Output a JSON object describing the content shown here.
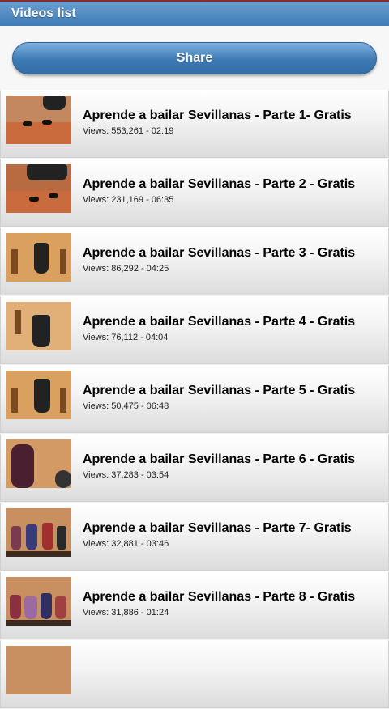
{
  "header": {
    "title": "Videos list"
  },
  "share": {
    "label": "Share"
  },
  "videos": [
    {
      "title": "Aprende a bailar Sevillanas - Parte 1- Gratis",
      "meta": "Views: 553,261 - 02:19"
    },
    {
      "title": "Aprende a bailar Sevillanas - Parte 2 - Gratis",
      "meta": "Views: 231,169 - 06:35"
    },
    {
      "title": "Aprende a bailar Sevillanas - Parte 3 - Gratis",
      "meta": "Views: 86,292 - 04:25"
    },
    {
      "title": "Aprende a bailar Sevillanas - Parte 4 - Gratis",
      "meta": "Views: 76,112 - 04:04"
    },
    {
      "title": "Aprende a bailar Sevillanas - Parte 5 - Gratis",
      "meta": "Views: 50,475 - 06:48"
    },
    {
      "title": "Aprende a bailar Sevillanas - Parte 6 - Gratis",
      "meta": "Views: 37,283 - 03:54"
    },
    {
      "title": "Aprende a bailar Sevillanas - Parte 7- Gratis",
      "meta": "Views: 32,881 - 03:46"
    },
    {
      "title": "Aprende a bailar Sevillanas - Parte 8 - Gratis",
      "meta": "Views: 31,886 - 01:24"
    }
  ]
}
